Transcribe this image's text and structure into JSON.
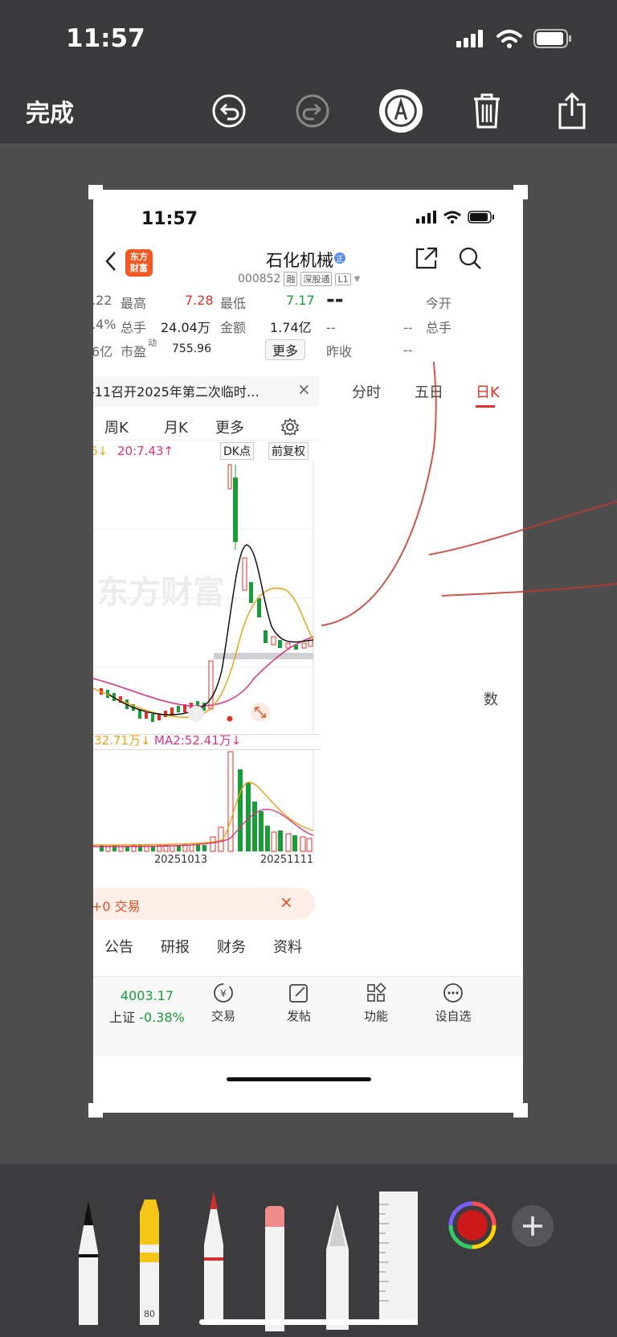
{
  "status": {
    "time": "11:57"
  },
  "toolbar": {
    "done_label": "完成"
  },
  "inner": {
    "time": "11:57",
    "logo_text": "东方\n财富",
    "stock_name": "石化机械",
    "stock_code": "000852",
    "tags": [
      "融",
      "深股通",
      "L1"
    ]
  },
  "quote": {
    "c1": [
      ".22",
      ".4%",
      "6亿"
    ],
    "high_label": "最高",
    "high": "7.28",
    "low_label": "最低",
    "low": "7.17",
    "hands_label": "总手",
    "hands": "24.04万",
    "amount_label": "金额",
    "amount": "1.74亿",
    "pe_label": "市盈",
    "pe_sup": "动",
    "pe": "755.96",
    "more": "更多",
    "right_dash_big": "--",
    "today_open": "今开",
    "right_dash1": "--",
    "right_dash2": "--",
    "right_hands": "总手",
    "prev_close": "昨收",
    "right_dash3": "--"
  },
  "notice": {
    "text": "-11召开2025年第二次临时…",
    "close": "×"
  },
  "tabs_right": [
    "分时",
    "五日",
    "日K"
  ],
  "kbar": [
    "周K",
    "月K",
    "更多"
  ],
  "ma_row": {
    "left": "6↓",
    "ma20": "20:7.43↑",
    "dk": "DK点",
    "fq": "前复权"
  },
  "chart_watermark": "东方财富",
  "vol_label": {
    "v1": ":32.71万↓",
    "v2": "MA2:52.41万↓"
  },
  "dates": [
    "20251013",
    "20251111"
  ],
  "trade_bar": {
    "text": "+0 交易",
    "close": "×"
  },
  "bottom_tabs": [
    "公告",
    "研报",
    "财务",
    "资料"
  ],
  "bottom_nav": {
    "index_value": "4003.17",
    "index_name": "上证",
    "index_change": "-0.38%",
    "items": [
      "交易",
      "发帖",
      "功能",
      "设自选"
    ]
  },
  "right_partial_char": "数",
  "tools": {
    "highlighter_number": "80"
  },
  "colors": {
    "red": "#e0302b",
    "green": "#1a9c3a",
    "accent": "#f25a22",
    "ink": "#c0392b"
  }
}
